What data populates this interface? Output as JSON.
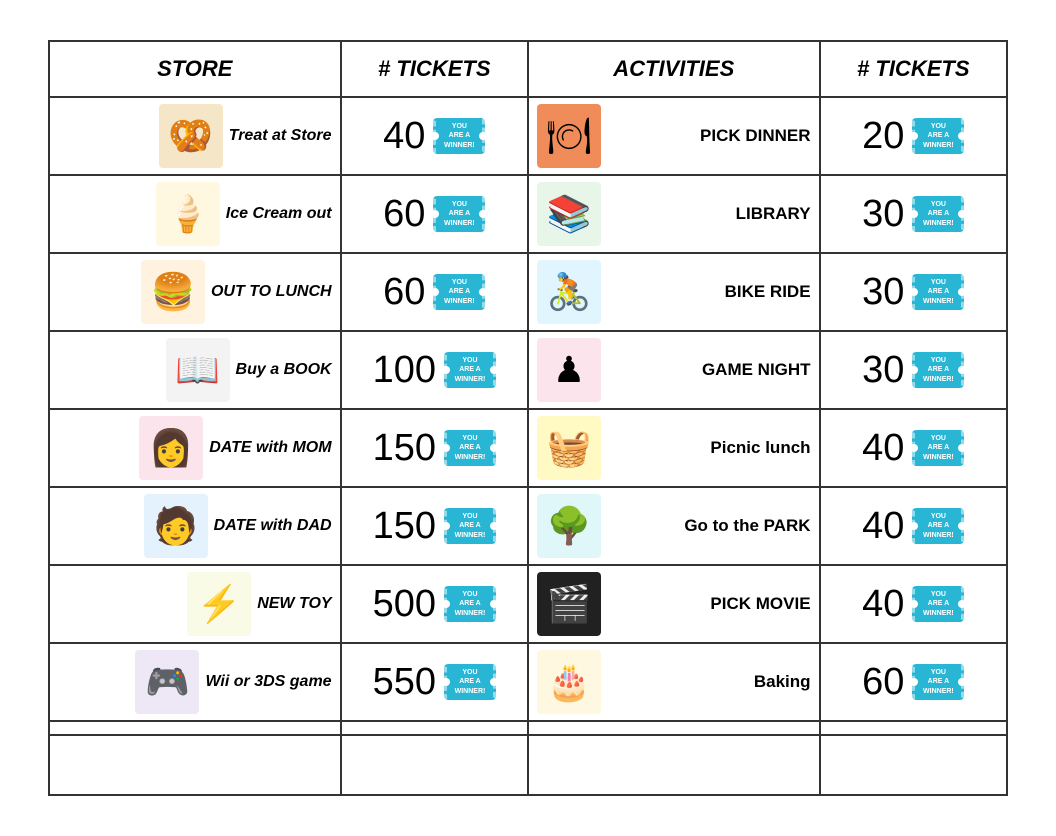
{
  "headers": {
    "store": "STORE",
    "tickets1": "# TICKETS",
    "activities": "ACTIVITIES",
    "tickets2": "# TICKETS"
  },
  "store_rows": [
    {
      "id": "treat",
      "label": "Treat at Store",
      "icon": "🥨",
      "icon_class": "icon-pretzel",
      "tickets": "40"
    },
    {
      "id": "icecream",
      "label": "Ice Cream out",
      "icon": "🍦",
      "icon_class": "icon-icecream",
      "tickets": "60"
    },
    {
      "id": "lunch",
      "label": "OUT TO LUNCH",
      "icon": "🍔",
      "icon_class": "icon-lunch",
      "tickets": "60"
    },
    {
      "id": "book",
      "label": "Buy a BOOK",
      "icon": "📖",
      "icon_class": "icon-book",
      "tickets": "100"
    },
    {
      "id": "mom",
      "label": "DATE with MOM",
      "icon": "👩",
      "icon_class": "icon-mom",
      "tickets": "150"
    },
    {
      "id": "dad",
      "label": "DATE with DAD",
      "icon": "🧑",
      "icon_class": "icon-dad",
      "tickets": "150"
    },
    {
      "id": "toy",
      "label": "NEW TOY",
      "icon": "⚡",
      "icon_class": "icon-toy",
      "tickets": "500"
    },
    {
      "id": "wii",
      "label": "Wii or 3DS game",
      "icon": "🎮",
      "icon_class": "icon-wii",
      "tickets": "550"
    }
  ],
  "activity_rows": [
    {
      "id": "dinner",
      "label": "PICK DINNER",
      "icon": "🍽",
      "icon_class": "icon-dinner",
      "tickets": "20"
    },
    {
      "id": "library",
      "label": "LIBRARY",
      "icon": "📚",
      "icon_class": "icon-library",
      "tickets": "30"
    },
    {
      "id": "bike",
      "label": "BIKE RIDE",
      "icon": "🚴",
      "icon_class": "icon-bike",
      "tickets": "30"
    },
    {
      "id": "game",
      "label": "GAME NIGHT",
      "icon": "♟",
      "icon_class": "icon-game",
      "tickets": "30"
    },
    {
      "id": "picnic",
      "label": "Picnic lunch",
      "icon": "🧺",
      "icon_class": "icon-picnic",
      "tickets": "40"
    },
    {
      "id": "park",
      "label": "Go to the PARK",
      "icon": "🌳",
      "icon_class": "icon-park",
      "tickets": "40"
    },
    {
      "id": "movie",
      "label": "PICK MOVIE",
      "icon": "🎬",
      "icon_class": "icon-movie",
      "tickets": "40"
    },
    {
      "id": "baking",
      "label": "Baking",
      "icon": "🎂",
      "icon_class": "icon-baking",
      "tickets": "60"
    }
  ],
  "ticket_label": "YOU ARE A WINNER!"
}
